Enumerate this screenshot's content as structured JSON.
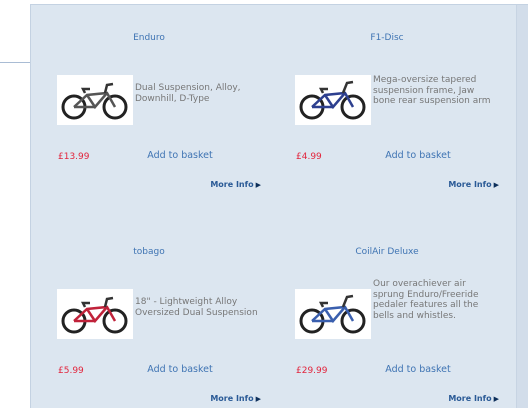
{
  "ui": {
    "more_info_label": "More Info",
    "add_to_basket_label": "Add to basket"
  },
  "products": [
    {
      "name": "Enduro",
      "description": "Dual Suspension, Alloy, Downhill, D-Type",
      "price": "£13.99",
      "bike_color": "#555555"
    },
    {
      "name": "F1-Disc",
      "description": "Mega-oversize tapered suspension frame, Jaw bone rear suspension arm",
      "price": "£4.99",
      "bike_color": "#2d3f8f"
    },
    {
      "name": "tobago",
      "description": "18\" - Lightweight Alloy Oversized Dual Suspension",
      "price": "£5.99",
      "bike_color": "#c0223a"
    },
    {
      "name": "CoilAir Deluxe",
      "description": "Our overachiever air sprung Enduro/Freeride pedaler features all the bells and whistles.",
      "price": "£29.99",
      "bike_color": "#3a5fae"
    }
  ],
  "colors": {
    "panel_bg": "#dce6f0",
    "link_blue": "#3f74b3",
    "price_red": "#e2253d"
  }
}
